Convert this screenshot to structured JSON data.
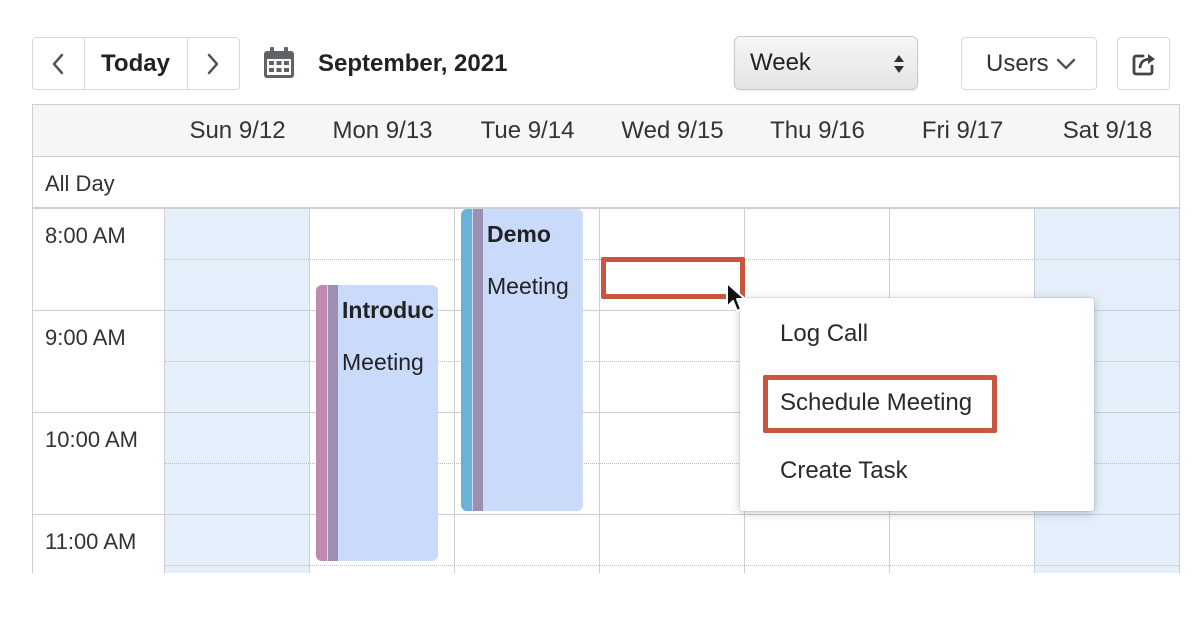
{
  "toolbar": {
    "prev_icon": "chevron-left-icon",
    "today_label": "Today",
    "next_icon": "chevron-right-icon",
    "calendar_icon": "calendar-icon",
    "month_label": "September, 2021",
    "view_select": {
      "value": "Week",
      "icon": "up-down-arrows-icon"
    },
    "users_label": "Users",
    "users_icon": "chevron-down-icon",
    "export_icon": "share-export-icon"
  },
  "calendar": {
    "days": [
      "Sun 9/12",
      "Mon 9/13",
      "Tue 9/14",
      "Wed 9/15",
      "Thu 9/16",
      "Fri 9/17",
      "Sat 9/18"
    ],
    "all_day_label": "All Day",
    "times": [
      "8:00 AM",
      "9:00 AM",
      "10:00 AM",
      "11:00 AM"
    ],
    "weekend_color": "#e4effb",
    "events": [
      {
        "title": "Introduc",
        "type": "Meeting",
        "day": "Mon 9/13",
        "start": "8:30 AM",
        "end": "11:30 AM",
        "color": "#c9dafa",
        "stripe_colors": [
          "#c08ab0",
          "#9b90b0"
        ]
      },
      {
        "title": "Demo",
        "type": "Meeting",
        "day": "Tue 9/14",
        "start": "8:00 AM",
        "end": "11:00 AM",
        "color": "#c9dafa",
        "stripe_colors": [
          "#6bb2d8",
          "#9b90b0"
        ]
      }
    ]
  },
  "context_menu": {
    "items": [
      "Log Call",
      "Schedule Meeting",
      "Create Task"
    ],
    "highlighted": "Schedule Meeting",
    "highlight_color": "#c9553f"
  }
}
